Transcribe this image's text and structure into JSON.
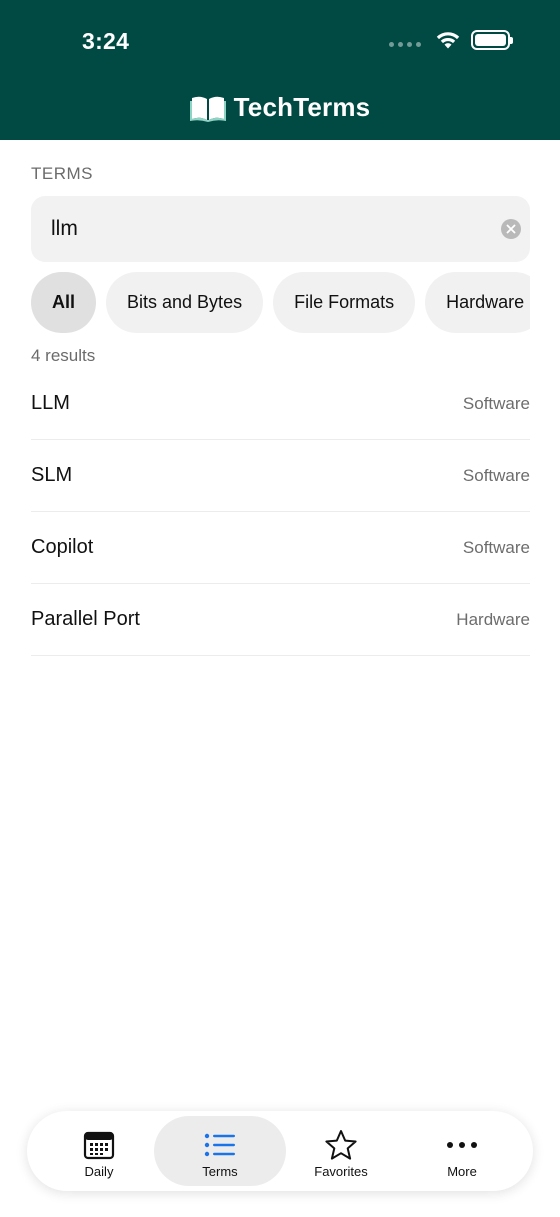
{
  "status": {
    "time": "3:24"
  },
  "header": {
    "title": "TechTerms",
    "color": "#014a44"
  },
  "section": {
    "label": "TERMS"
  },
  "search": {
    "value": "llm"
  },
  "filters": [
    {
      "label": "All",
      "active": true
    },
    {
      "label": "Bits and Bytes",
      "active": false
    },
    {
      "label": "File Formats",
      "active": false
    },
    {
      "label": "Hardware",
      "active": false
    }
  ],
  "results": {
    "count_text": "4 results",
    "items": [
      {
        "title": "LLM",
        "category": "Software"
      },
      {
        "title": "SLM",
        "category": "Software"
      },
      {
        "title": "Copilot",
        "category": "Software"
      },
      {
        "title": "Parallel Port",
        "category": "Hardware"
      }
    ]
  },
  "tabbar": {
    "accent": "#1a73e8",
    "tabs": [
      {
        "label": "Daily",
        "icon": "calendar-icon",
        "active": false
      },
      {
        "label": "Terms",
        "icon": "list-icon",
        "active": true
      },
      {
        "label": "Favorites",
        "icon": "star-icon",
        "active": false
      },
      {
        "label": "More",
        "icon": "more-icon",
        "active": false
      }
    ]
  }
}
